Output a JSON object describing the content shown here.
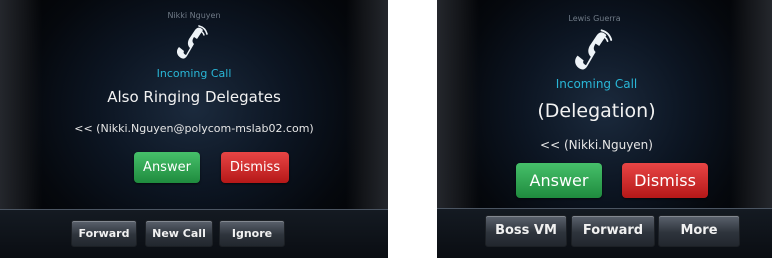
{
  "screens": [
    {
      "caller_name": "Nikki Nguyen",
      "status": "Incoming Call",
      "heading": "Also Ringing Delegates",
      "from_line": "<< (Nikki.Nguyen@polycom-mslab02.com)",
      "answer_label": "Answer",
      "dismiss_label": "Dismiss",
      "softkeys": [
        "Forward",
        "New Call",
        "Ignore"
      ]
    },
    {
      "caller_name": "Lewis Guerra",
      "status": "Incoming Call",
      "heading": "(Delegation)",
      "from_line": "<< (Nikki.Nguyen)",
      "answer_label": "Answer",
      "dismiss_label": "Dismiss",
      "softkeys": [
        "Boss VM",
        "Forward",
        "More"
      ]
    }
  ],
  "colors": {
    "status": "#29b6d6",
    "answer": "#2fa650",
    "dismiss": "#d12a2a",
    "background": "#0c1522"
  },
  "icons": {
    "call": "handset-icon"
  }
}
